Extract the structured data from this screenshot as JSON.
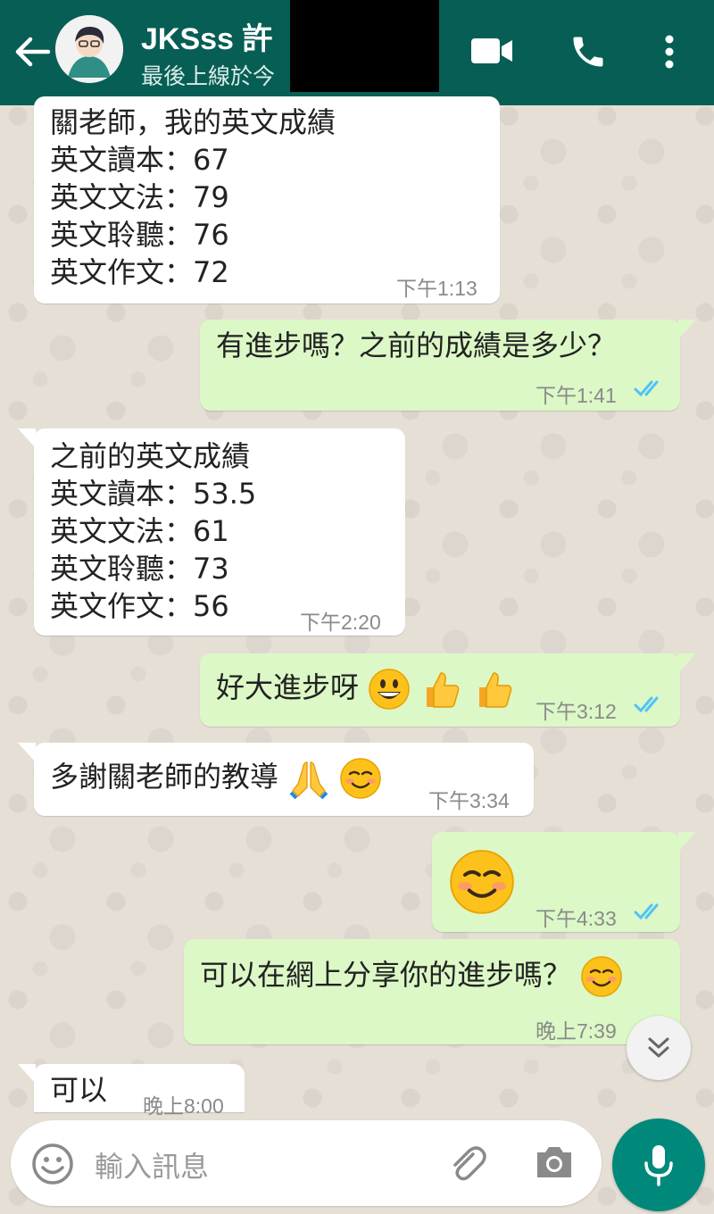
{
  "header": {
    "contact_name": "JKSss 許",
    "status": "最後上線於今"
  },
  "messages": [
    {
      "lines": [
        "關老師，我的英文成績",
        "英文讀本：67",
        "英文文法：79",
        "英文聆聽：76",
        "英文作文：72"
      ],
      "time": "下午1:13"
    },
    {
      "lines": [
        "有進步嗎？之前的成績是多少？"
      ],
      "time": "下午1:41"
    },
    {
      "lines": [
        "之前的英文成績",
        "英文讀本：53.5",
        "英文文法：61",
        "英文聆聽：73",
        "英文作文：56"
      ],
      "time": "下午2:20"
    },
    {
      "lines": [
        "好大進步呀"
      ],
      "time": "下午3:12"
    },
    {
      "lines": [
        "多謝關老師的教導"
      ],
      "time": "下午3:34"
    },
    {
      "lines": [],
      "time": "下午4:33"
    },
    {
      "lines": [
        "可以在網上分享你的進步嗎？"
      ],
      "time": "晚上7:39"
    },
    {
      "lines": [
        "可以"
      ],
      "time": "晚上8:00"
    }
  ],
  "input": {
    "placeholder": "輸入訊息"
  },
  "icons": {
    "back": "arrow-left-icon",
    "video": "video-camera-icon",
    "call": "phone-icon",
    "menu": "more-vertical-icon",
    "emoji": "smiley-icon",
    "attach": "paperclip-icon",
    "camera": "camera-icon",
    "mic": "microphone-icon",
    "scroll": "double-chevron-down-icon",
    "read_receipt": "double-check-icon"
  },
  "colors": {
    "header": "#075e54",
    "outgoing_bubble": "#dcf8c6",
    "incoming_bubble": "#ffffff",
    "read_ticks": "#4fc3f7",
    "mic_button": "#00897b"
  }
}
